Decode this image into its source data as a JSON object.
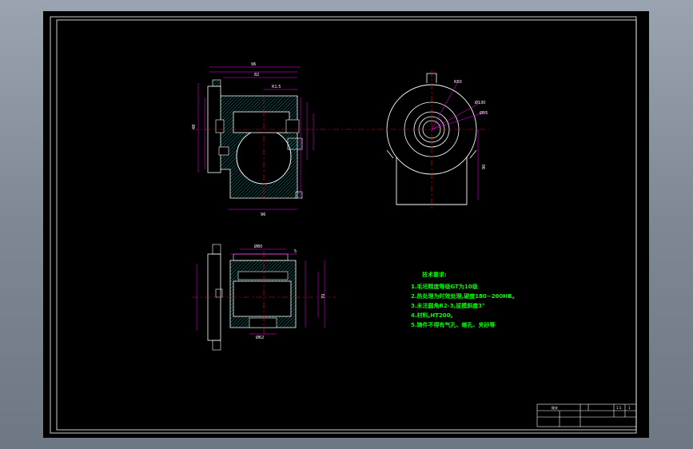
{
  "colors": {
    "background": "#8a949e",
    "paper": "#000000",
    "frame": "#ffffff",
    "dimension": "#ff00ff",
    "outline": "#ffffff",
    "centerline": "#ff0000",
    "hatch": "#00b8b8",
    "notes": "#00ff00"
  },
  "tech_notes": {
    "title": "技术要求:",
    "lines": [
      "1.毛坯精度等级GT为10级",
      "2.热处理为时效处理,硬度180~200HB。",
      "3.未注圆角R2-3,拔模斜度3°",
      "4.材料,HT200。",
      "5.铸件不得有气孔、缩孔、夹砂等"
    ]
  },
  "dims": {
    "d1": "R50",
    "d2": "Ø130",
    "d3": "Ø55",
    "d4": "90",
    "d5": "70",
    "d6": "Ø80",
    "d7": "Ø62",
    "d8": "5"
  },
  "title_block": {
    "part_name": "拨叉",
    "scale": "1:1",
    "qty": "1"
  }
}
